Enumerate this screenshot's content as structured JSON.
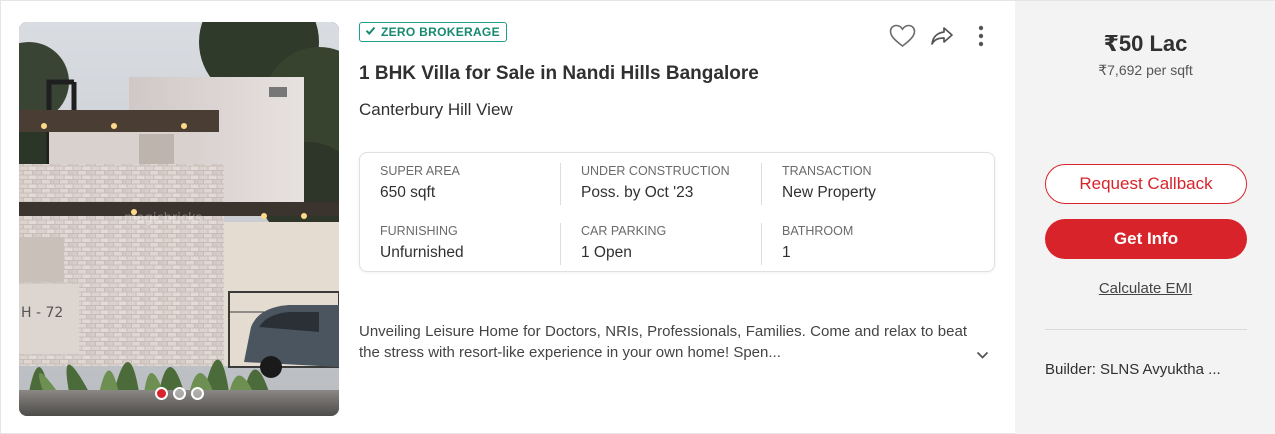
{
  "listing": {
    "badge": "ZERO BROKERAGE",
    "title": "1 BHK Villa for Sale in Nandi Hills Bangalore",
    "project": "Canterbury Hill View",
    "image_watermark": "magicbricks",
    "house_number": "H - 72",
    "carousel": {
      "count": 3,
      "active_index": 0
    },
    "specs": [
      {
        "label": "SUPER AREA",
        "value": "650 sqft"
      },
      {
        "label": "UNDER CONSTRUCTION",
        "value": "Poss. by Oct '23"
      },
      {
        "label": "TRANSACTION",
        "value": "New Property"
      },
      {
        "label": "FURNISHING",
        "value": "Unfurnished"
      },
      {
        "label": "CAR PARKING",
        "value": "1 Open"
      },
      {
        "label": "BATHROOM",
        "value": "1"
      }
    ],
    "description": "Unveiling Leisure Home for Doctors, NRIs, Professionals, Families. Come and relax to beat the stress with resort-like experience in your own home! Spen...",
    "icons": [
      "check-icon",
      "heart-icon",
      "share-icon",
      "more-vertical-icon",
      "chevron-down-icon"
    ]
  },
  "side": {
    "price": "₹50 Lac",
    "price_per_sqft": "₹7,692 per sqft",
    "request_callback": "Request Callback",
    "get_info": "Get Info",
    "calculate_emi": "Calculate EMI",
    "builder": "Builder: SLNS Avyuktha ..."
  },
  "colors": {
    "brand_red": "#d8232a",
    "badge_green": "#16896f",
    "side_bg": "#f3f3f3"
  }
}
